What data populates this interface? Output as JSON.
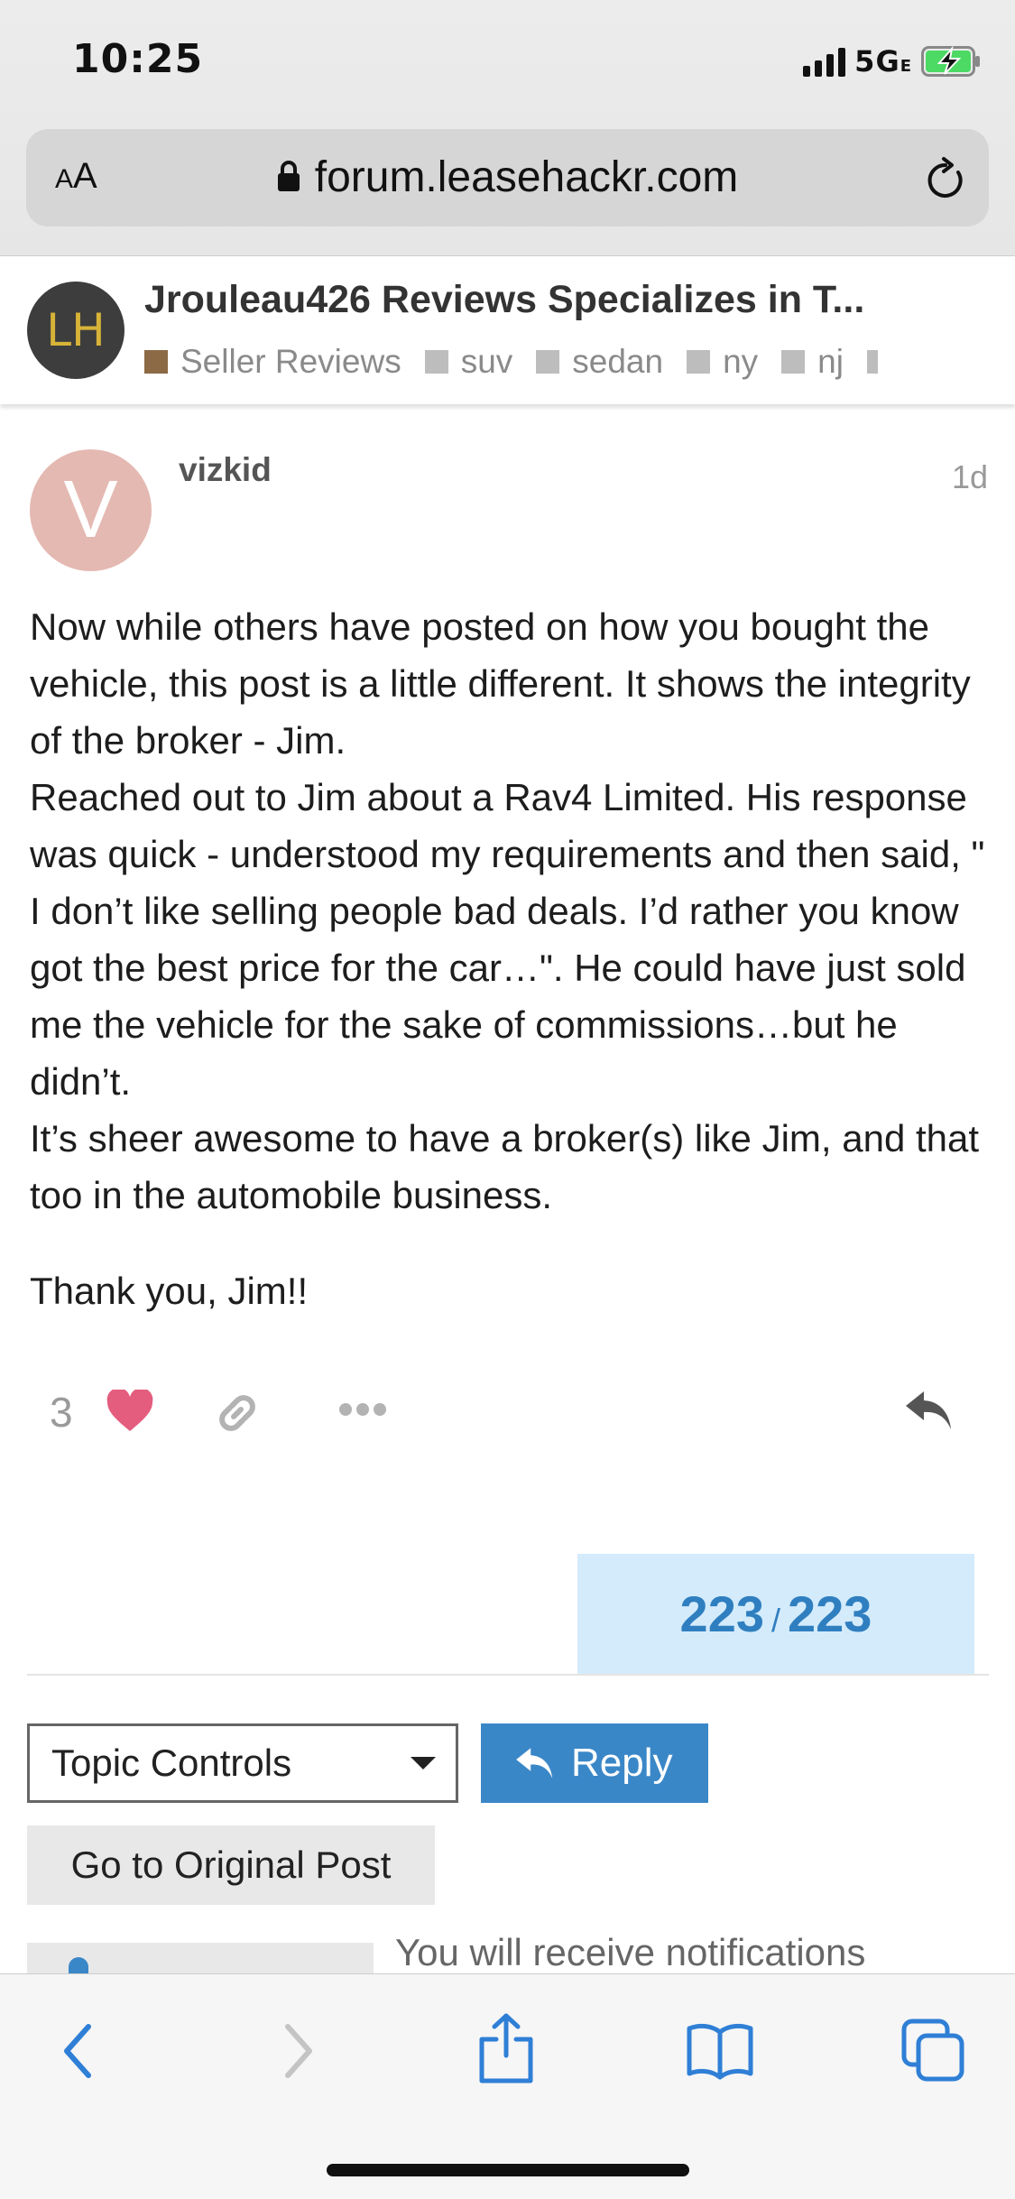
{
  "status_bar": {
    "time": "10:25",
    "network": "5G",
    "network_suffix": "E"
  },
  "browser": {
    "text_size_label": "AA",
    "url": "forum.leasehackr.com"
  },
  "topic": {
    "logo_text": "LH",
    "title": "Jrouleau426 Reviews Specializes in T...",
    "tags": [
      "Seller Reviews",
      "suv",
      "sedan",
      "ny",
      "nj"
    ]
  },
  "post": {
    "avatar_letter": "V",
    "username": "vizkid",
    "age": "1d",
    "body": [
      "Now while others have posted on how you bought the vehicle, this post is a little different. It shows the integrity of the broker - Jim.",
      "Reached out to Jim about a Rav4 Limited. His response was quick - understood my requirements and then said, \" I don’t like selling people bad deals. I’d rather you know got the best price for the car…\". He could have just sold me the vehicle for the sake of commissions…but he didn’t.",
      "It’s sheer awesome to have a broker(s) like Jim, and that too in the automobile business.",
      "Thank you, Jim!!"
    ],
    "like_count": "3",
    "accent_like": "#e45d7e"
  },
  "timeline": {
    "current": "223",
    "separator": "/",
    "total": "223"
  },
  "footer_controls": {
    "topic_controls_label": "Topic Controls",
    "reply_label": "Reply",
    "original_post_label": "Go to Original Post",
    "notification_text": "You will receive notifications"
  },
  "icons": {
    "toolbar": [
      "back-icon",
      "forward-icon",
      "share-icon",
      "bookmarks-icon",
      "tabs-icon"
    ]
  },
  "colors": {
    "accent_blue": "#3a87c8",
    "progress_bg": "#d4ebfb"
  }
}
